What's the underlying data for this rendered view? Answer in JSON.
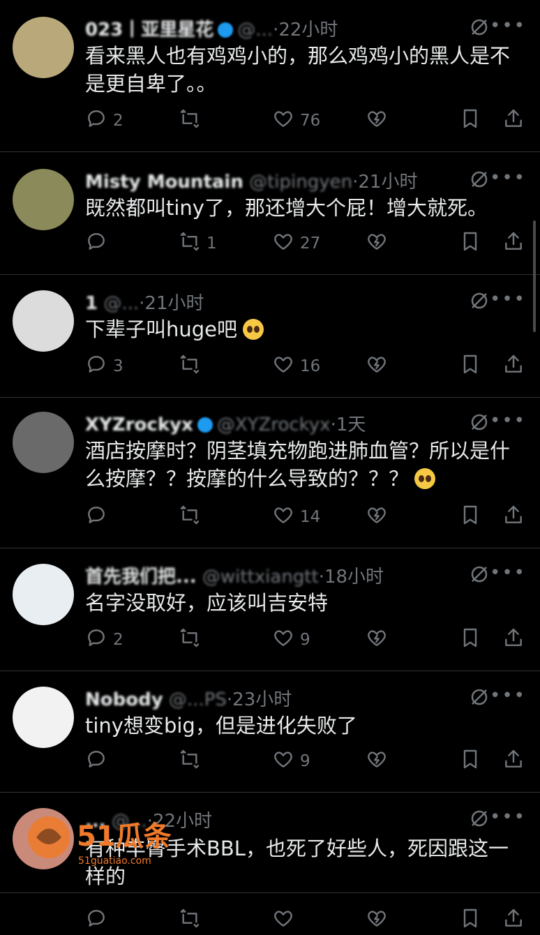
{
  "tweets": [
    {
      "name": "023丨亚里星花",
      "handle": "@...",
      "time": "22小时",
      "text": "看来黑人也有鸡鸡小的，那么鸡鸡小的黑人是不是更自卑了。。",
      "replies": "2",
      "retweets": "",
      "likes": "76",
      "verified": true,
      "avatar_color": "#b9a97a"
    },
    {
      "name": "Misty Mountain",
      "handle": "@tipingyen",
      "time": "21小时",
      "text": "既然都叫tiny了，那还增大个屁！增大就死。",
      "replies": "",
      "retweets": "1",
      "likes": "27",
      "verified": false,
      "avatar_color": "#8a8a5a"
    },
    {
      "name": "1",
      "handle": "@...",
      "time": "21小时",
      "text": "下辈子叫huge吧",
      "emoji": true,
      "replies": "3",
      "retweets": "",
      "likes": "16",
      "verified": false,
      "avatar_color": "#dcdcdc"
    },
    {
      "name": "XYZrockyx",
      "handle": "@XYZrockyx",
      "time": "1天",
      "text": "酒店按摩时？阴茎填充物跑进肺血管？所以是什么按摩？？按摩的什么导致的？？？",
      "emoji": true,
      "replies": "",
      "retweets": "",
      "likes": "14",
      "verified": true,
      "avatar_color": "#6a6a6a"
    },
    {
      "name": "首先我们把...",
      "handle": "@wittxiangtt",
      "time": "18小时",
      "text": "名字没取好，应该叫吉安特",
      "replies": "2",
      "retweets": "",
      "likes": "9",
      "verified": false,
      "avatar_color": "#e8eef2"
    },
    {
      "name": "Nobody",
      "handle": "@...PS",
      "time": "23小时",
      "text": "tiny想变big，但是进化失败了",
      "replies": "",
      "retweets": "",
      "likes": "9",
      "verified": false,
      "avatar_color": "#f2f2f2"
    },
    {
      "name": "...",
      "handle": "@...",
      "time": "22小时",
      "text": "有种丰臀手术BBL，也死了好些人，死因跟这一样的",
      "replies": "",
      "retweets": "",
      "likes": "",
      "verified": false,
      "avatar_color": "#c98a7a"
    }
  ],
  "watermark": {
    "text": "51瓜条",
    "sub": "51guatiao.com",
    "color": "#f07a2a"
  },
  "icons": {
    "reply": "reply-icon",
    "retweet": "retweet-icon",
    "like": "heart-icon",
    "views": "broken-heart-icon",
    "bookmark": "bookmark-icon",
    "share": "share-icon",
    "grok": "grok-icon",
    "more": "more-icon"
  }
}
